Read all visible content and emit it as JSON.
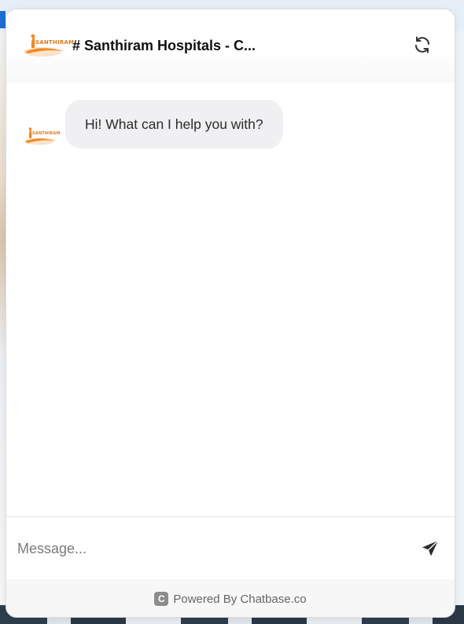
{
  "chat": {
    "title": "# Santhiram Hospitals - C...",
    "logo_text": "SANTHIRAM",
    "refresh_icon": "refresh-icon",
    "messages": [
      {
        "role": "bot",
        "text": "Hi! What can I help you with?"
      }
    ],
    "input": {
      "placeholder": "Message...",
      "value": ""
    },
    "send_icon": "send-icon",
    "footer": {
      "badge": "C",
      "label": "Powered By Chatbase.co"
    }
  },
  "colors": {
    "brand_orange": "#f08a24",
    "bubble_bg": "#f0f0f2",
    "footer_bg": "#f7f7f7"
  }
}
